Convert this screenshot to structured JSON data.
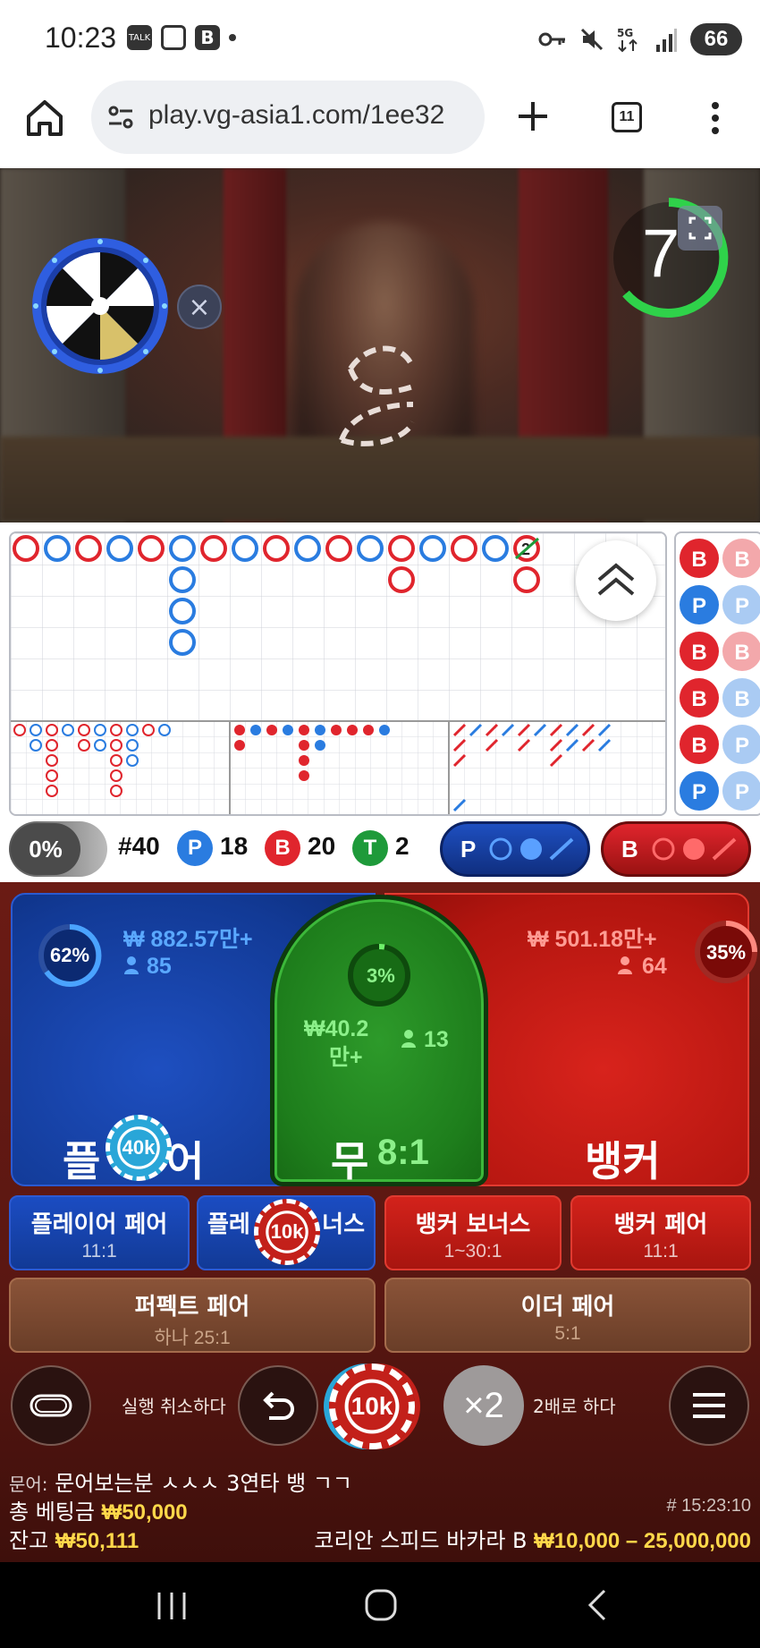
{
  "status_bar": {
    "time": "10:23",
    "left_icons": [
      "talk-icon",
      "screenshot-icon",
      "b-app-icon",
      "dot"
    ],
    "right_icons": [
      "vpn-key-icon",
      "mute-icon",
      "5g-icon",
      "signal-icon"
    ],
    "battery": "66"
  },
  "browser": {
    "url": "play.vg-asia1.com/1ee32",
    "tab_count": "11"
  },
  "video": {
    "countdown": "7"
  },
  "stats": {
    "percent_toggle": "0%",
    "round": "#40",
    "player_label": "P",
    "player_count": "18",
    "banker_label": "B",
    "banker_count": "20",
    "tie_label": "T",
    "tie_count": "2",
    "player_predict": "P",
    "banker_predict": "B"
  },
  "side_road_labels": [
    "B",
    "B",
    "P",
    "P",
    "B",
    "B",
    "B",
    "B",
    "B",
    "P",
    "P",
    "P"
  ],
  "bets": {
    "player": {
      "label_left": "플",
      "label_right": "어",
      "amount": "₩ 882.57만+",
      "players": "85",
      "percent": "62%",
      "chip": "40k"
    },
    "tie": {
      "label": "무",
      "odds": "8:1",
      "amount_line1": "₩40.2",
      "amount_line2": "만+",
      "players": "13",
      "percent": "3%"
    },
    "banker": {
      "label": "뱅커",
      "amount": "₩ 501.18만+",
      "players": "64",
      "percent": "35%"
    },
    "player_pair": {
      "label": "플레이어 페어",
      "odds": "11:1"
    },
    "player_bonus": {
      "label_left": "플레",
      "label_right": "너스",
      "chip": "10k"
    },
    "banker_bonus": {
      "label": "뱅커 보너스",
      "odds": "1~30:1"
    },
    "banker_pair": {
      "label": "뱅커 페어",
      "odds": "11:1"
    },
    "perfect_pair": {
      "label": "퍼펙트 페어",
      "odds": "하나 25:1"
    },
    "either_pair": {
      "label": "이더 페어",
      "odds": "5:1"
    }
  },
  "controls": {
    "undo_label": "실행 취소하다",
    "selected_chip": "10k",
    "double_label": "×2",
    "double_text": "2배로 하다"
  },
  "info": {
    "chat_user": "문어:",
    "chat_message": "문어보는분 ㅅㅅㅅ 3연타 뱅 ㄱㄱ",
    "total_bet_label": "총 베팅금",
    "total_bet_value": "₩50,000",
    "game_id": "# 15:23:10",
    "balance_label": "잔고",
    "balance_value": "₩50,111",
    "table_name": "코리안 스피드 바카라 B",
    "limits": "₩10,000 – 25,000,000"
  },
  "colors": {
    "player_blue": "#1e4fc0",
    "banker_red": "#c91a14",
    "tie_green": "#1e7e1c",
    "highlight_yellow": "#ffd84a"
  }
}
